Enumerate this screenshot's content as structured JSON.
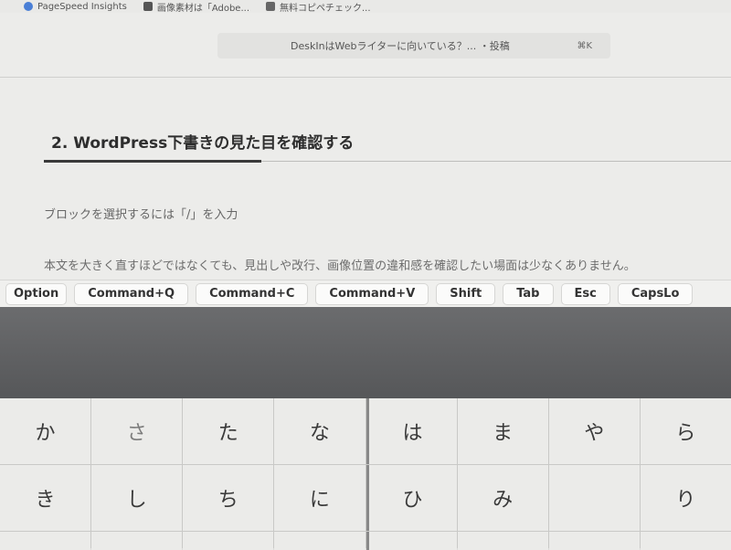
{
  "bookmarks": [
    {
      "label": "PageSpeed Insights",
      "icon": "pagespeed-icon"
    },
    {
      "label": "画像素材は「Adobe...",
      "icon": "image-icon"
    },
    {
      "label": "無料コピペチェック...",
      "icon": "copy-check-icon"
    }
  ],
  "command_bar": {
    "title": "DeskInはWebライターに向いている？...",
    "separator": "・投稿",
    "shortcut": "⌘K"
  },
  "editor": {
    "heading": "2. WordPress下書きの見た目を確認する",
    "paragraph1": "ブロックを選択するには「/」を入力",
    "paragraph2": "本文を大きく直すほどではなくても、見出しや改行、画像位置の違和感を確認したい場面は少なくありません。"
  },
  "toolbar": {
    "keys": [
      "Option",
      "Command+Q",
      "Command+C",
      "Command+V",
      "Shift",
      "Tab",
      "Esc",
      "CapsLo"
    ]
  },
  "keyboard": {
    "row1": [
      "か",
      "さ",
      "た",
      "な",
      "は",
      "ま",
      "や",
      "ら"
    ],
    "row2": [
      "き",
      "し",
      "ち",
      "に",
      "ひ",
      "み",
      "",
      "り"
    ]
  }
}
